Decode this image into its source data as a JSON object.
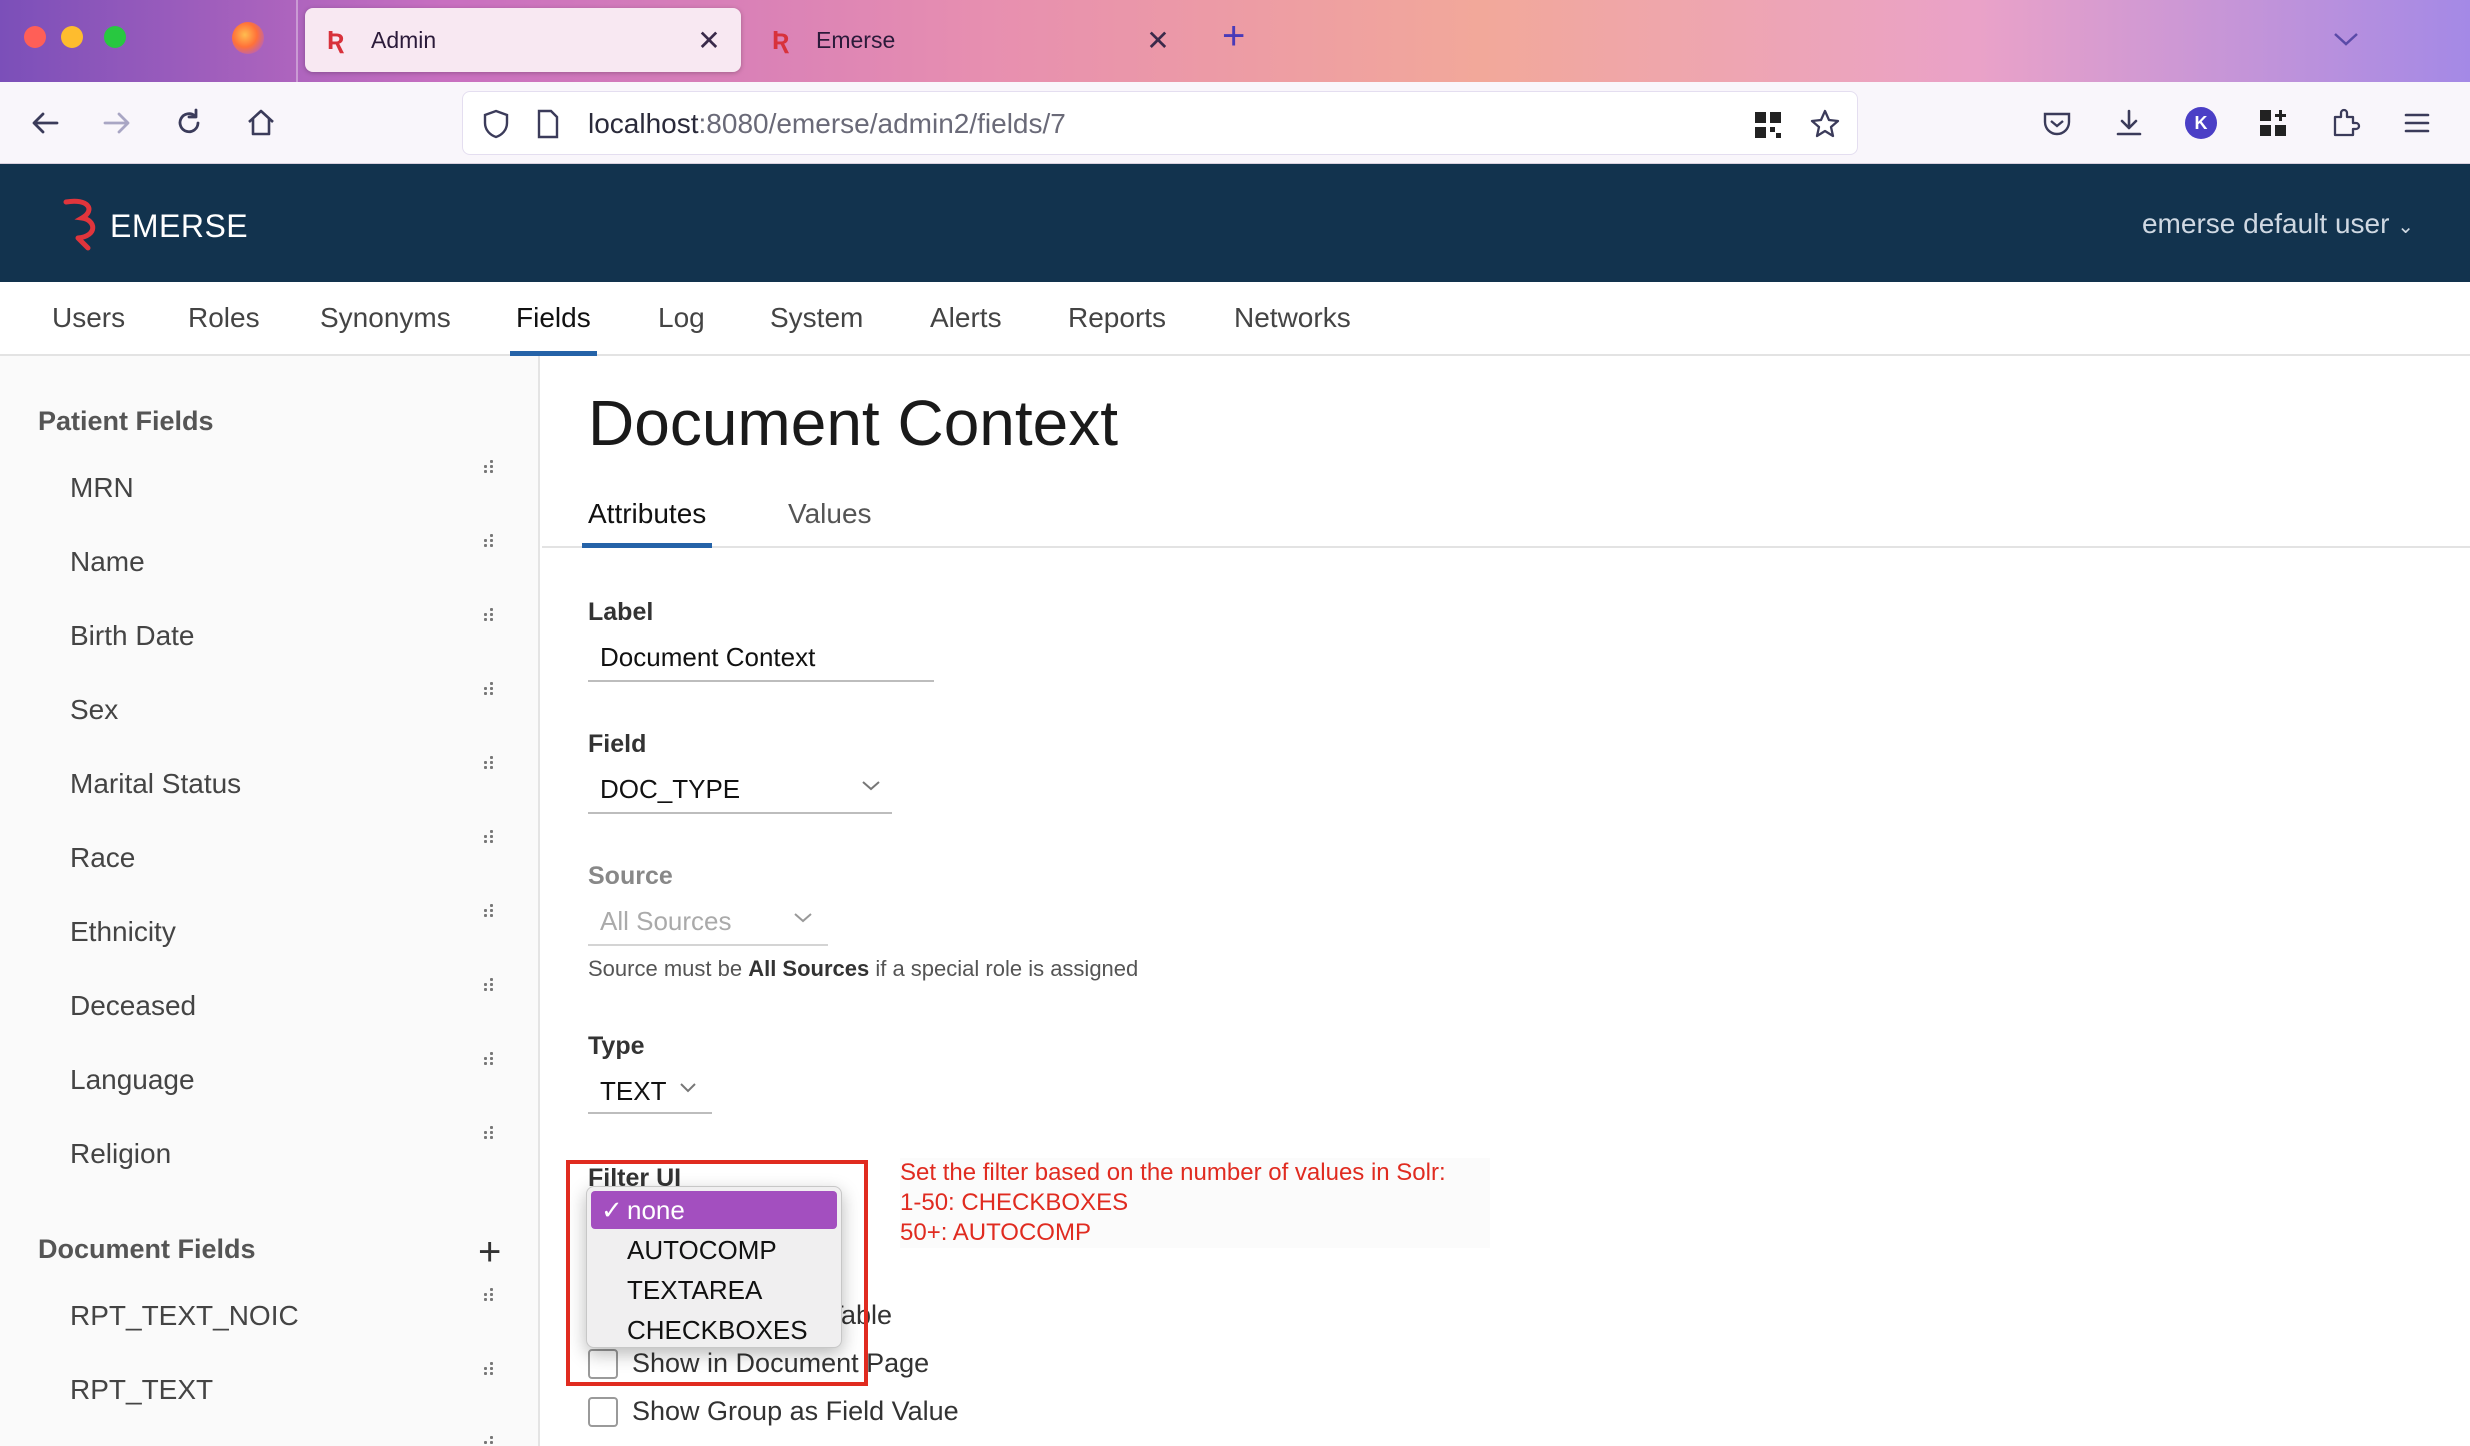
{
  "browser": {
    "tabs": [
      {
        "title": "Admin",
        "active": true
      },
      {
        "title": "Emerse",
        "active": false
      }
    ],
    "url": {
      "host": "localhost",
      "path": ":8080/emerse/admin2/fields/7"
    },
    "profile_initial": "K"
  },
  "app": {
    "logo_text": "EMERSE",
    "user_menu": "emerse default user"
  },
  "admin_tabs": [
    "Users",
    "Roles",
    "Synonyms",
    "Fields",
    "Log",
    "System",
    "Alerts",
    "Reports",
    "Networks"
  ],
  "sidebar": {
    "patient_heading": "Patient Fields",
    "patient_fields": [
      "MRN",
      "Name",
      "Birth Date",
      "Sex",
      "Marital Status",
      "Race",
      "Ethnicity",
      "Deceased",
      "Language",
      "Religion"
    ],
    "document_heading": "Document Fields",
    "document_fields": [
      "RPT_TEXT_NOIC",
      "RPT_TEXT"
    ]
  },
  "main": {
    "title": "Document Context",
    "subtabs": [
      "Attributes",
      "Values"
    ],
    "label": {
      "caption": "Label",
      "value": "Document Context"
    },
    "field": {
      "caption": "Field",
      "value": "DOC_TYPE"
    },
    "source": {
      "caption": "Source",
      "value": "All Sources",
      "help_prefix": "Source must be ",
      "help_bold": "All Sources",
      "help_suffix": " if a special role is assigned"
    },
    "type": {
      "caption": "Type",
      "value": "TEXT"
    },
    "filter_ui": {
      "caption": "Filter UI",
      "options": [
        "none",
        "AUTOCOMP",
        "TEXTAREA",
        "CHECKBOXES"
      ],
      "selected": "none"
    },
    "checkboxes": [
      {
        "label": "Show in Values Table",
        "visible_fragment": "es Table",
        "checked": false
      },
      {
        "label": "Show in Document Page",
        "checked": false
      },
      {
        "label": "Show Group as Field Value",
        "checked": false
      }
    ]
  },
  "annotation": {
    "lines": [
      "Set the filter based on the number of values in Solr:",
      "1-50: CHECKBOXES",
      "50+: AUTOCOMP"
    ],
    "color": "#e02b20"
  },
  "colors": {
    "header_bg": "#12334e",
    "active_tab_underline": "#2563a8",
    "dropdown_selected": "#a34fbf",
    "highlight": "#e02b20"
  }
}
